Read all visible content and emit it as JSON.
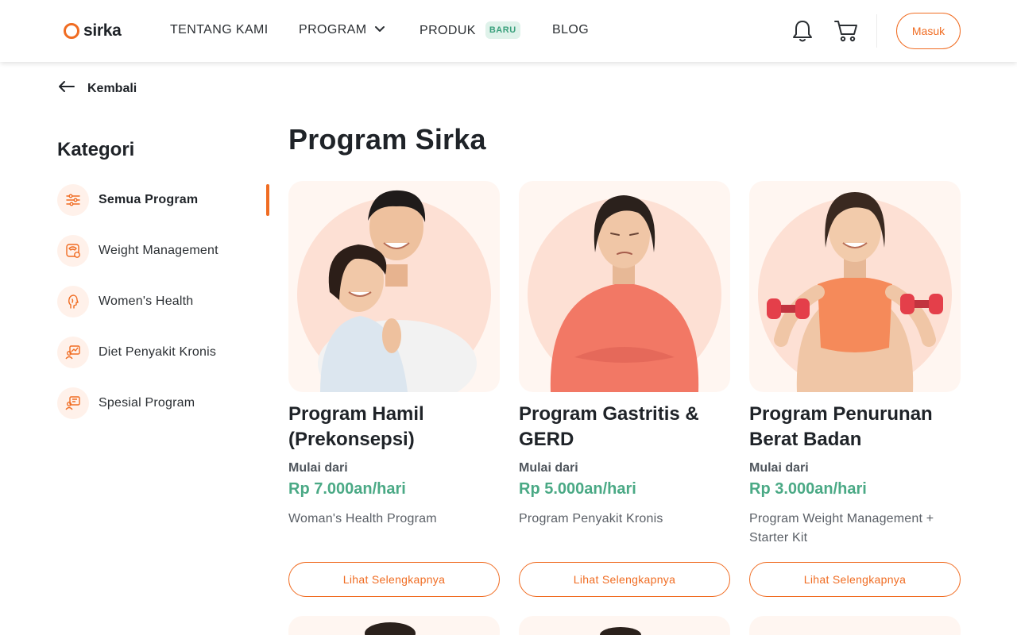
{
  "brand": {
    "name": "sirka",
    "color": "#f06c22"
  },
  "nav": {
    "items": [
      {
        "label": "TENTANG KAMI"
      },
      {
        "label": "PROGRAM"
      },
      {
        "label": "PRODUK",
        "badge": "BARU"
      },
      {
        "label": "BLOG"
      }
    ],
    "login_label": "Masuk"
  },
  "back_label": "Kembali",
  "sidebar": {
    "title": "Kategori",
    "items": [
      {
        "label": "Semua Program",
        "icon": "filter-sliders-icon",
        "active": true
      },
      {
        "label": "Weight Management",
        "icon": "scale-icon"
      },
      {
        "label": "Women's Health",
        "icon": "woman-profile-icon"
      },
      {
        "label": "Diet Penyakit Kronis",
        "icon": "chart-person-icon"
      },
      {
        "label": "Spesial Program",
        "icon": "special-program-icon"
      }
    ]
  },
  "main": {
    "title": "Program Sirka",
    "cards": [
      {
        "title": "Program Hamil (Prekonsepsi)",
        "from_label": "Mulai dari",
        "price": "Rp 7.000an/hari",
        "desc": "Woman's Health Program",
        "button": "Lihat Selengkapnya",
        "image": "couple-photo"
      },
      {
        "title": "Program Gastritis & GERD",
        "from_label": "Mulai dari",
        "price": "Rp 5.000an/hari",
        "desc": "Program Penyakit Kronis",
        "button": "Lihat Selengkapnya",
        "image": "woman-stomach-pain-photo"
      },
      {
        "title": "Program Penurunan Berat Badan",
        "from_label": "Mulai dari",
        "price": "Rp 3.000an/hari",
        "desc": "Program Weight Management + Starter Kit",
        "button": "Lihat Selengkapnya",
        "image": "woman-dumbbells-photo"
      }
    ]
  },
  "colors": {
    "accent": "#f06c22",
    "price": "#4aa985",
    "badge_bg": "#dff2ea",
    "card_bg": "#fff6f1"
  }
}
